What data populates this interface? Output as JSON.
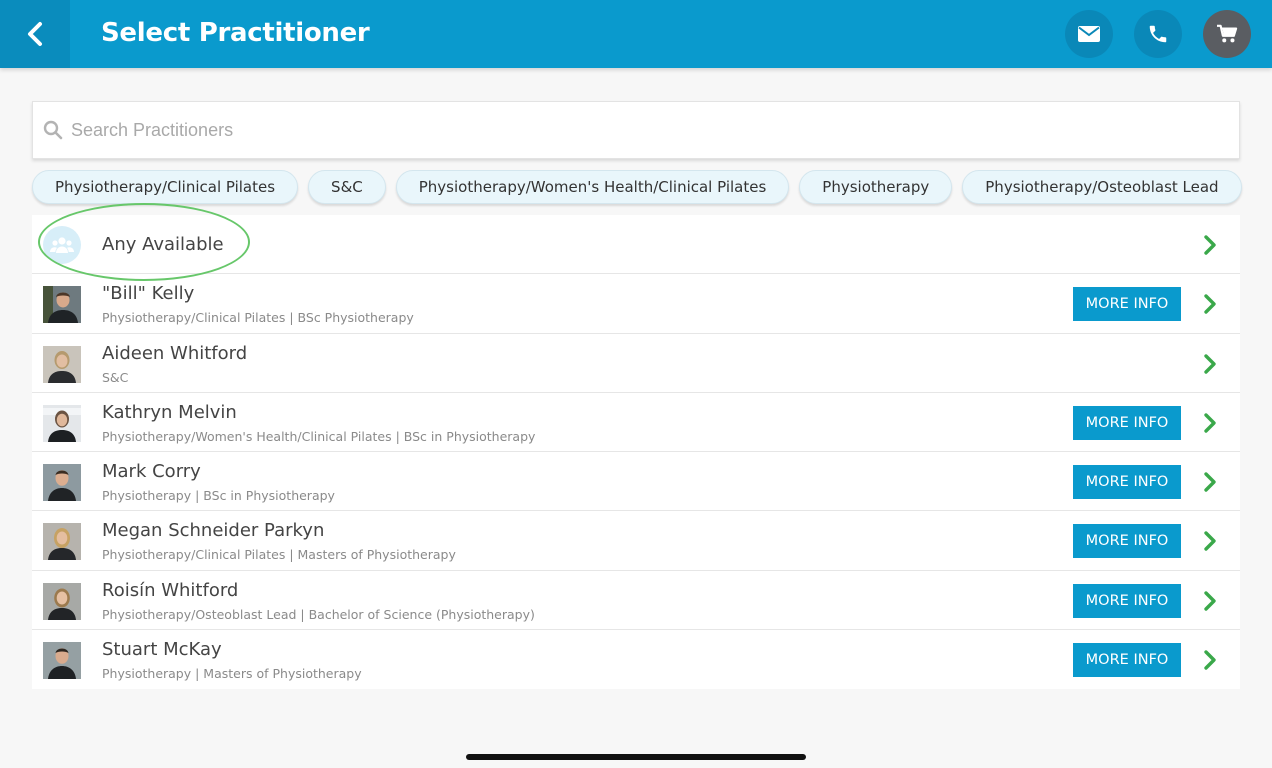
{
  "header": {
    "title": "Select Practitioner",
    "icons": [
      "chevron-left-icon",
      "envelope-icon",
      "phone-icon",
      "cart-icon"
    ],
    "color": "#0a9acd"
  },
  "search": {
    "placeholder": "Search Practitioners",
    "value": ""
  },
  "chips": [
    "Physiotherapy/Clinical Pilates",
    "S&C",
    "Physiotherapy/Women's Health/Clinical Pilates",
    "Physiotherapy",
    "Physiotherapy/Osteoblast Lead"
  ],
  "any_available": {
    "label": "Any Available",
    "icon": "group-icon"
  },
  "more_info_label": "MORE INFO",
  "practitioners": [
    {
      "name": "\"Bill\" Kelly",
      "details": "Physiotherapy/Clinical Pilates | BSc Physiotherapy",
      "has_more_info": true
    },
    {
      "name": "Aideen Whitford",
      "details": "S&C",
      "has_more_info": false
    },
    {
      "name": "Kathryn Melvin",
      "details": "Physiotherapy/Women's Health/Clinical Pilates | BSc in Physiotherapy",
      "has_more_info": true
    },
    {
      "name": "Mark Corry",
      "details": "Physiotherapy | BSc in Physiotherapy",
      "has_more_info": true
    },
    {
      "name": "Megan Schneider Parkyn",
      "details": "Physiotherapy/Clinical Pilates | Masters of Physiotherapy",
      "has_more_info": true
    },
    {
      "name": "Roisín Whitford",
      "details": "Physiotherapy/Osteoblast Lead | Bachelor of Science (Physiotherapy)",
      "has_more_info": true
    },
    {
      "name": "Stuart McKay",
      "details": "Physiotherapy | Masters of Physiotherapy",
      "has_more_info": true
    }
  ]
}
